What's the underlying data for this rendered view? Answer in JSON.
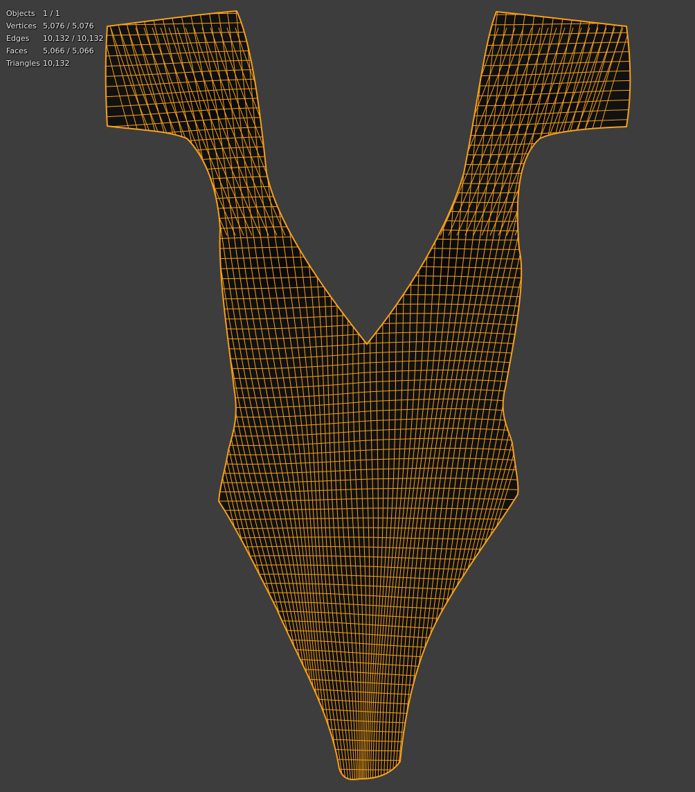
{
  "viewport": {
    "background_color": "#3d3d3d",
    "object": {
      "kind": "mesh-wireframe",
      "shape": "one-piece-swimsuit",
      "edge_color": "#f7a11a",
      "face_color": "#111111"
    }
  },
  "stats": [
    {
      "label": "Objects",
      "value": "1 / 1"
    },
    {
      "label": "Vertices",
      "value": "5,076 / 5,076"
    },
    {
      "label": "Edges",
      "value": "10,132 / 10,132"
    },
    {
      "label": "Faces",
      "value": "5,066 / 5,066"
    },
    {
      "label": "Triangles",
      "value": "10,132"
    }
  ]
}
